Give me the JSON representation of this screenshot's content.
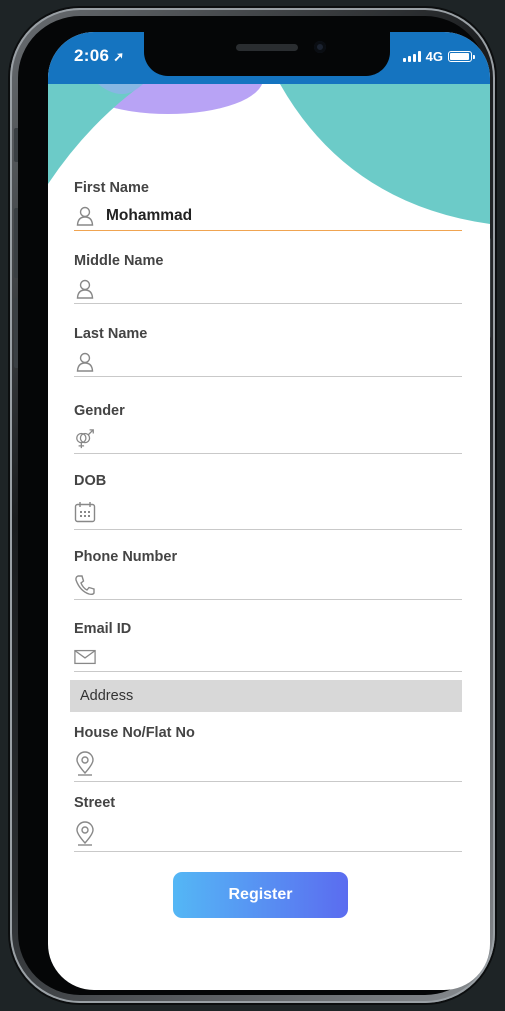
{
  "status_bar": {
    "time": "2:06",
    "network": "4G"
  },
  "form": {
    "fields": [
      {
        "label": "First Name",
        "value": "Mohammad",
        "icon": "person-icon"
      },
      {
        "label": "Middle Name",
        "value": "",
        "icon": "person-icon"
      },
      {
        "label": "Last Name",
        "value": "",
        "icon": "person-icon"
      },
      {
        "label": "Gender",
        "value": "",
        "icon": "gender-icon"
      },
      {
        "label": "DOB",
        "value": "",
        "icon": "calendar-icon"
      },
      {
        "label": "Phone Number",
        "value": "",
        "icon": "phone-icon"
      },
      {
        "label": "Email ID",
        "value": "",
        "icon": "mail-icon"
      }
    ],
    "address_section": "Address",
    "address_fields": [
      {
        "label": "House No/Flat No",
        "value": "",
        "icon": "location-pin-icon"
      },
      {
        "label": "Street",
        "value": "",
        "icon": "location-pin-icon"
      }
    ],
    "register_label": "Register"
  },
  "colors": {
    "status_bar": "#1574c0",
    "accent_underline": "#f0a451",
    "teal_decoration": "#6ccbc8",
    "purple_decoration": "#b8a3f5",
    "button_gradient_start": "#54b7f5",
    "button_gradient_end": "#5b6cf0"
  }
}
